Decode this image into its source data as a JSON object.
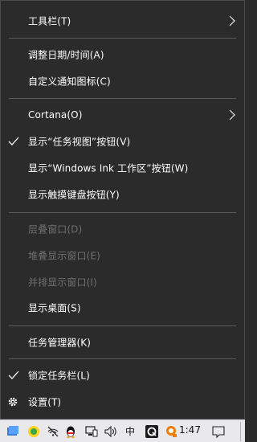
{
  "menu": {
    "items": [
      {
        "label": "工具栏(T)",
        "has_submenu": true
      },
      {
        "label": "调整日期/时间(A)"
      },
      {
        "label": "自定义通知图标(C)"
      },
      {
        "label": "Cortana(O)",
        "has_submenu": true
      },
      {
        "label": "显示“任务视图”按钮(V)",
        "checked": true
      },
      {
        "label": "显示“Windows Ink 工作区”按钮(W)"
      },
      {
        "label": "显示触摸键盘按钮(Y)"
      },
      {
        "label": "层叠窗口(D)",
        "disabled": true
      },
      {
        "label": "堆叠显示窗口(E)",
        "disabled": true
      },
      {
        "label": "并排显示窗口(I)",
        "disabled": true
      },
      {
        "label": "显示桌面(S)"
      },
      {
        "label": "任务管理器(K)"
      },
      {
        "label": "锁定任务栏(L)",
        "checked": true
      },
      {
        "label": "设置(T)",
        "icon": "gear-icon"
      }
    ]
  },
  "taskbar": {
    "ime_label": "中",
    "clock": "1:47",
    "icons": [
      "cloud-sync-icon",
      "ime-app-icon",
      "wifi-blocked-icon",
      "qq-penguin-icon",
      "network-icon",
      "volume-icon",
      "q-app-icon",
      "assistant-icon",
      "notification-icon"
    ]
  }
}
